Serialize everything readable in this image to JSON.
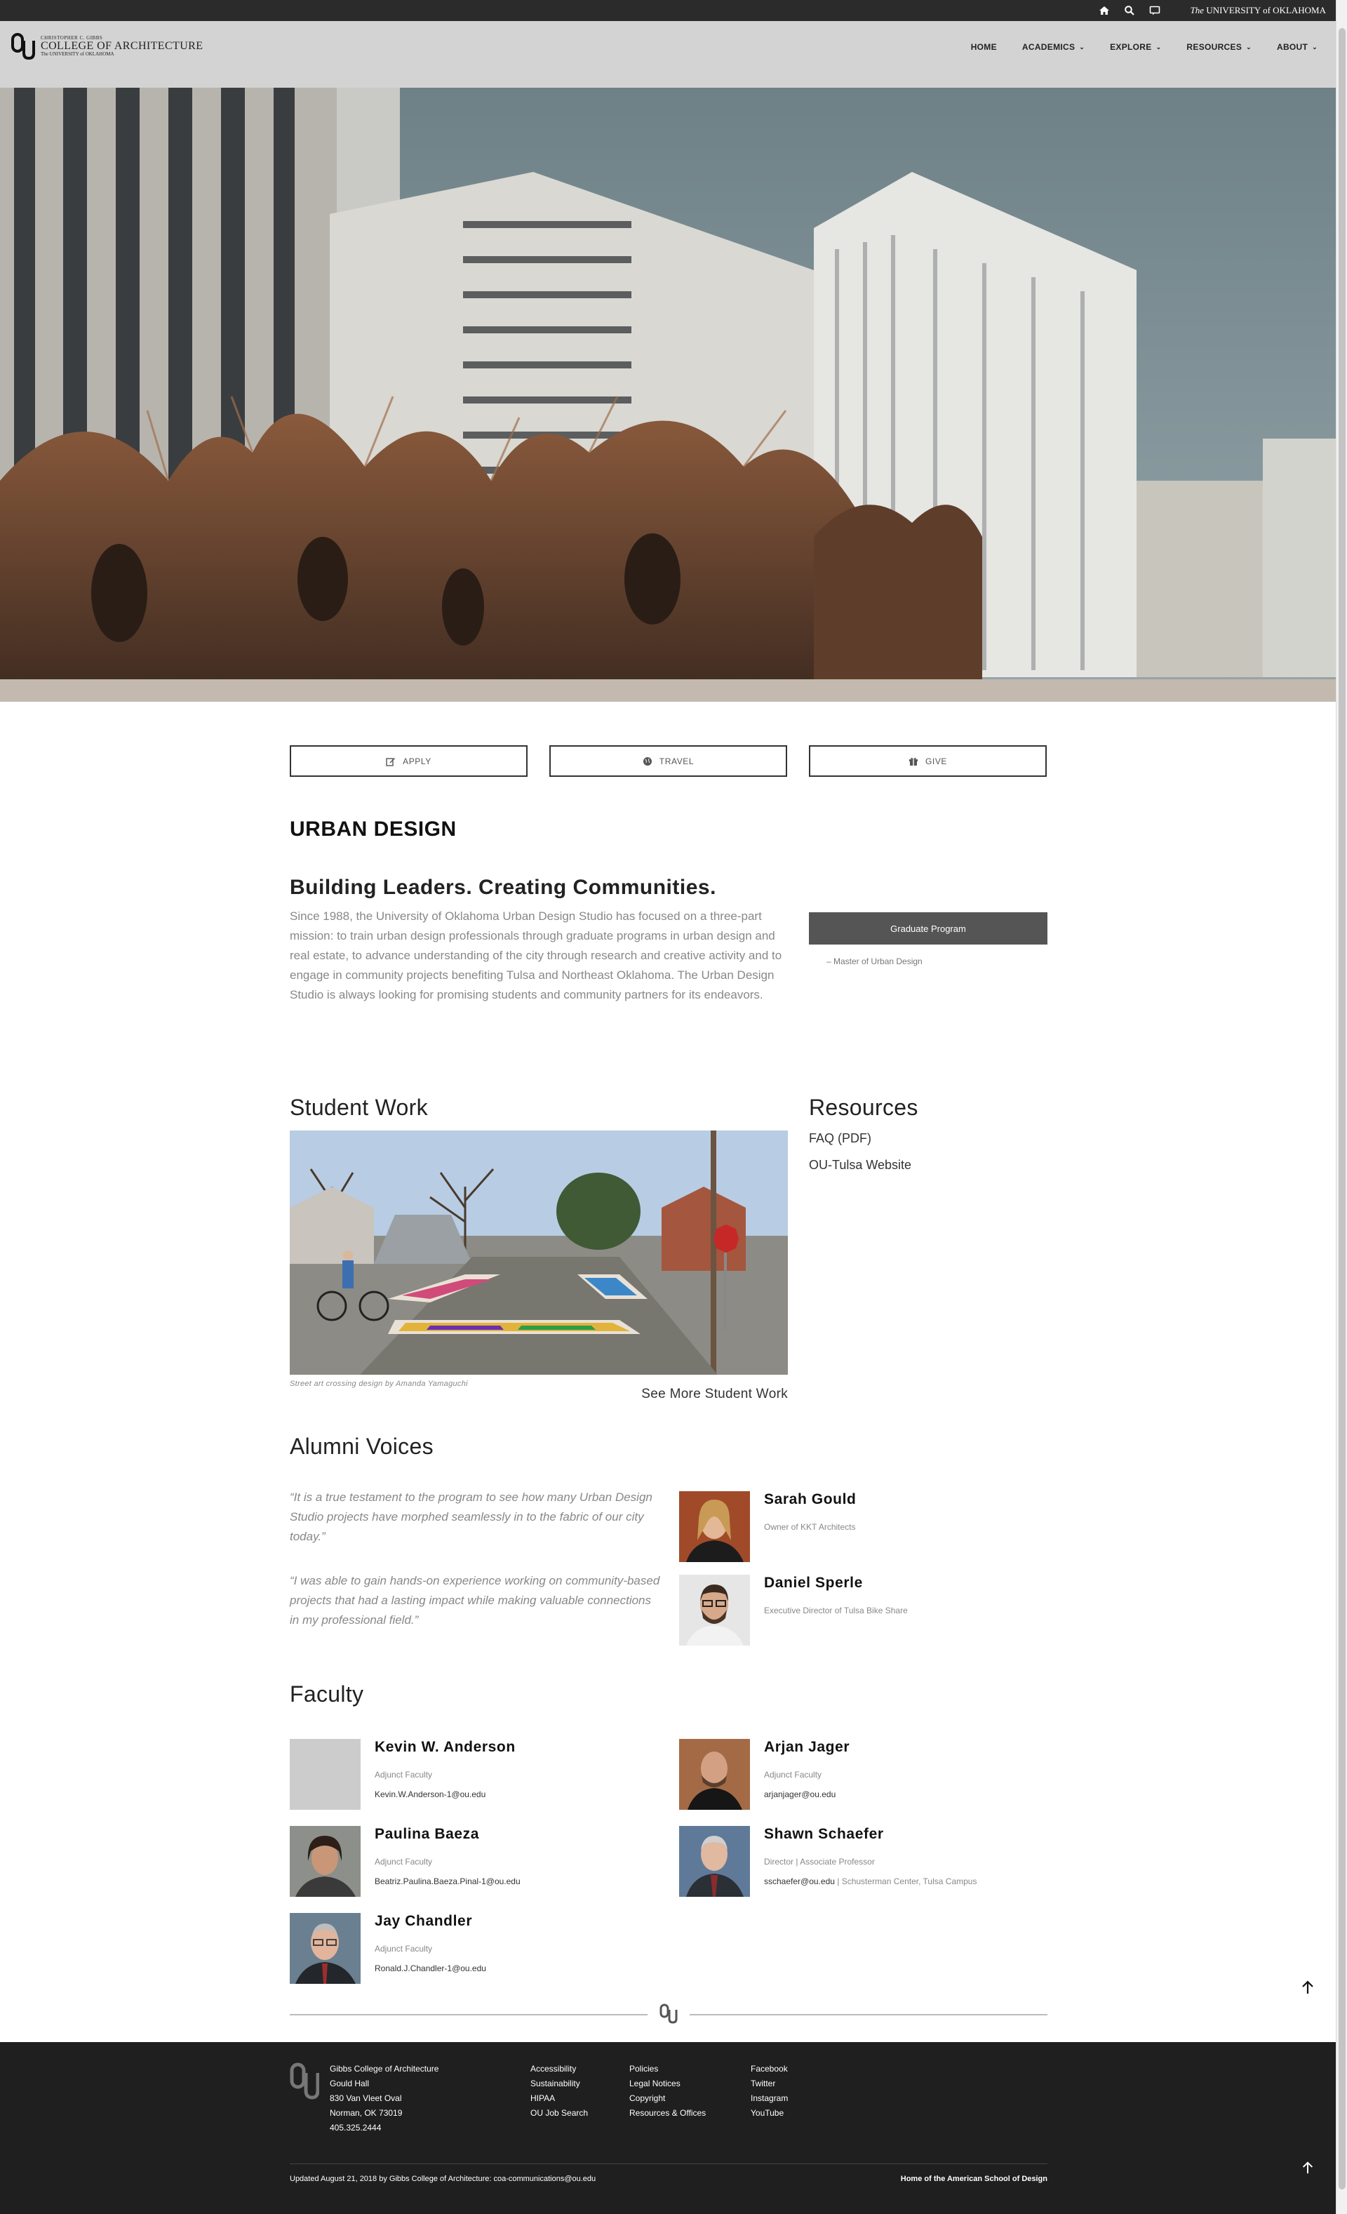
{
  "utility": {
    "icons": [
      "home-icon",
      "search-icon",
      "chat-icon"
    ],
    "ou_prefix": "The",
    "ou_name": "UNIVERSITY of OKLAHOMA"
  },
  "header": {
    "logo_line1": "CHRISTOPHER C. GIBBS",
    "logo_line2": "COLLEGE OF ARCHITECTURE",
    "logo_line3": "The UNIVERSITY of OKLAHOMA",
    "nav": [
      {
        "label": "HOME",
        "dropdown": false
      },
      {
        "label": "ACADEMICS",
        "dropdown": true
      },
      {
        "label": "EXPLORE",
        "dropdown": true
      },
      {
        "label": "RESOURCES",
        "dropdown": true
      },
      {
        "label": "ABOUT",
        "dropdown": true
      }
    ]
  },
  "cta": {
    "apply": "APPLY",
    "travel": "TRAVEL",
    "give": "GIVE"
  },
  "page": {
    "title": "URBAN DESIGN",
    "tagline": "Building Leaders. Creating Communities.",
    "intro": "Since 1988, the University of Oklahoma Urban Design Studio has focused on a three-part mission: to train urban design professionals through graduate programs in urban design and real estate, to advance understanding of the city through research and creative activity and to engage in community projects benefiting Tulsa and Northeast Oklahoma. The Urban Design Studio is always looking for promising students and community partners for its endeavors.",
    "grad_button": "Graduate Program",
    "grad_link": "– Master of Urban Design"
  },
  "student_work": {
    "title": "Student Work",
    "caption": "Street art crossing design by Amanda Yamaguchi",
    "see_more": "See More Student Work"
  },
  "resources": {
    "title": "Resources",
    "links": [
      "FAQ (PDF)",
      "OU-Tulsa Website"
    ]
  },
  "alumni": {
    "title": "Alumni Voices",
    "quotes": [
      "“It is a true testament to the program to see how many Urban Design Studio projects have morphed seamlessly in to the fabric of our city today.”",
      "“I was able to gain hands-on experience working on community-based projects that had a lasting impact while making valuable connections in my professional field.”"
    ],
    "people": [
      {
        "name": "Sarah Gould",
        "role": "Owner of KKT Architects"
      },
      {
        "name": "Daniel Sperle",
        "role": "Executive Director of Tulsa Bike Share"
      }
    ]
  },
  "faculty": {
    "title": "Faculty",
    "members": [
      {
        "name": "Kevin W. Anderson",
        "role": "Adjunct Faculty",
        "email": "Kevin.W.Anderson-1@ou.edu",
        "location": ""
      },
      {
        "name": "Arjan Jager",
        "role": "Adjunct Faculty",
        "email": "arjanjager@ou.edu",
        "location": ""
      },
      {
        "name": "Paulina Baeza",
        "role": "Adjunct Faculty",
        "email": "Beatriz.Paulina.Baeza.Pinal-1@ou.edu",
        "location": ""
      },
      {
        "name": "Shawn Schaefer",
        "role": "Director | Associate Professor",
        "email": "sschaefer@ou.edu",
        "location": " | Schusterman Center, Tulsa Campus"
      },
      {
        "name": "Jay Chandler",
        "role": "Adjunct Faculty",
        "email": "Ronald.J.Chandler-1@ou.edu",
        "location": ""
      }
    ]
  },
  "footer": {
    "address": [
      "Gibbs College of Architecture",
      "Gould Hall",
      "830 Van Vleet Oval",
      "Norman, OK 73019",
      "405.325.2444"
    ],
    "col1": [
      "Accessibility",
      "Sustainability",
      "HIPAA",
      "OU Job Search"
    ],
    "col2": [
      "Policies",
      "Legal Notices",
      "Copyright",
      "Resources & Offices"
    ],
    "col3": [
      "Facebook",
      "Twitter",
      "Instagram",
      "YouTube"
    ],
    "updated": "Updated August 21, 2018 by Gibbs College of Architecture: coa-communications@ou.edu",
    "tagline": "Home of the American School of Design"
  },
  "colors": {
    "utility_bar": "#2b2b2b",
    "header": "#d3d3d3",
    "button_dark": "#555555",
    "footer": "#1f1f1f"
  }
}
